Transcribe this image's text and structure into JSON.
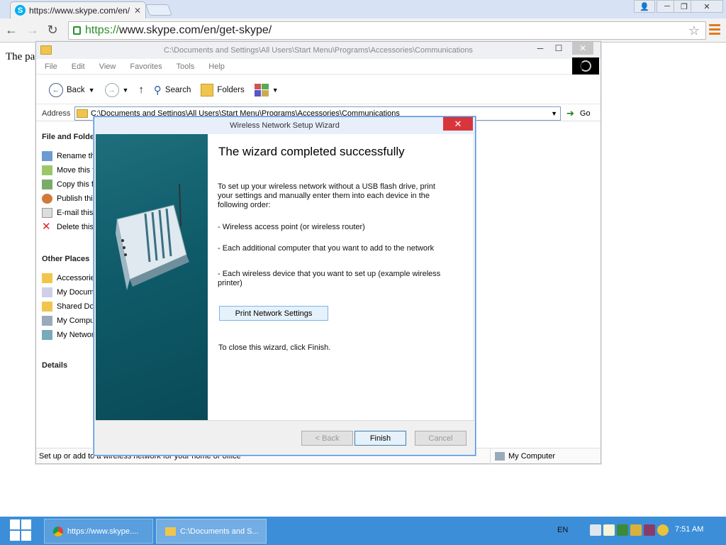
{
  "browser": {
    "tab_title": "https://www.skype.com/en/",
    "url_prefix": "https://",
    "url_rest": "www.skype.com/en/get-skype/",
    "page_text": "The pa"
  },
  "explorer": {
    "title": "C:\\Documents and Settings\\All Users\\Start Menu\\Programs\\Accessories\\Communications",
    "menu": [
      "File",
      "Edit",
      "View",
      "Favorites",
      "Tools",
      "Help"
    ],
    "toolbar": {
      "back": "Back",
      "search": "Search",
      "folders": "Folders"
    },
    "address_label": "Address",
    "address_value": "C:\\Documents and Settings\\All Users\\Start Menu\\Programs\\Accessories\\Communications",
    "go_label": "Go",
    "tasks_header": "File and Folde",
    "tasks": [
      "Rename thi",
      "Move this f",
      "Copy this f",
      "Publish this",
      "E-mail this",
      "Delete this"
    ],
    "places_header": "Other Places",
    "places": [
      "Accessorie",
      "My Docume",
      "Shared Doc",
      "My Comput",
      "My Networ"
    ],
    "details_header": "Details",
    "status_text": "Set up or add to a wireless network for your home or office",
    "status_computer": "My Computer"
  },
  "wizard": {
    "title": "Wireless Network Setup Wizard",
    "heading": "The wizard completed successfully",
    "intro": "To set up your wireless network without a USB flash drive, print your settings and manually enter them into each device in the following order:",
    "item1": "- Wireless access point (or wireless router)",
    "item2": "- Each additional computer that you want to add to the network",
    "item3": "- Each wireless device that you want to set up (example wireless printer)",
    "print_button": "Print Network Settings",
    "close_text": "To close this wizard, click Finish.",
    "back_button": "< Back",
    "finish_button": "Finish",
    "cancel_button": "Cancel"
  },
  "taskbar": {
    "task1": "https://www.skype....",
    "task2": "C:\\Documents and S...",
    "lang": "EN",
    "time": "7:51 AM"
  }
}
